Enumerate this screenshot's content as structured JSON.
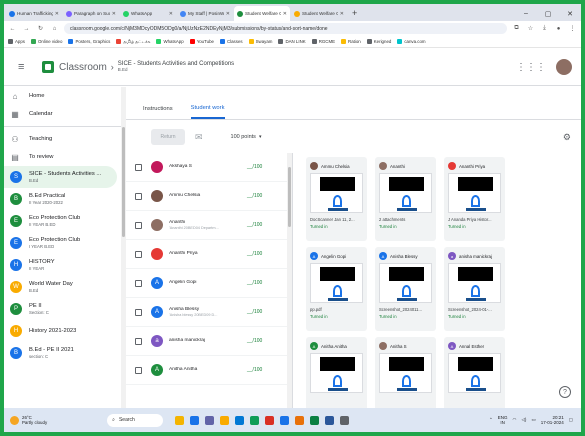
{
  "browser": {
    "tabs": [
      {
        "label": "Human Trafficking Awaren",
        "color": "#1a73e8"
      },
      {
        "label": "Paragraph on Success - C",
        "color": "#7b61ff"
      },
      {
        "label": "WhatsApp",
        "color": "#25d366"
      },
      {
        "label": "My Staff | PosinWyMail",
        "color": "#4285f4"
      },
      {
        "label": "Student Welfare Committ",
        "color": "#1e8e3e",
        "active": true
      },
      {
        "label": "Student Welfare Committ",
        "color": "#f9ab00"
      }
    ],
    "new_tab": "+",
    "window_controls": [
      "–",
      "▢",
      "✕"
    ],
    "url": "classroom.google.com/c/NjM3MDcyODM5ODg0/a/NjUzNzE2NDEyNjM3/submissions/by-status/and-sort-name/done",
    "bookmarks": [
      {
        "label": "Apps",
        "color": "#5f6368"
      },
      {
        "label": "Online video",
        "color": "#34a853"
      },
      {
        "label": "Posters, Graphics",
        "color": "#1a73e8"
      },
      {
        "label": "தமிழ் தட்டச்சு",
        "color": "#ea4335"
      },
      {
        "label": "WhatsApp",
        "color": "#25d366"
      },
      {
        "label": "YouTube",
        "color": "#ff0000"
      },
      {
        "label": "Classes",
        "color": "#1a73e8"
      },
      {
        "label": "Swayam",
        "color": "#fbbc04"
      },
      {
        "label": "DAN LINK",
        "color": "#5f6368"
      },
      {
        "label": "RGCME",
        "color": "#5f6368"
      },
      {
        "label": "Ration",
        "color": "#fbbc04"
      },
      {
        "label": "Kerigned",
        "color": "#5f6368"
      },
      {
        "label": "canva.com",
        "color": "#00c4cc"
      }
    ]
  },
  "header": {
    "app_name": "Classroom",
    "class_title": "SICE - Students Activities and Competitions",
    "class_subtitle": "B.Ed"
  },
  "sidebar": {
    "items": [
      {
        "label": "Home",
        "icon": "⌂"
      },
      {
        "label": "Calendar",
        "icon": "▦"
      }
    ],
    "teaching_label": "Teaching",
    "to_review_label": "To review",
    "classes": [
      {
        "initial": "S",
        "name": "SICE - Students Activities ...",
        "sub": "B.Ed",
        "color": "#1a73e8",
        "selected": true
      },
      {
        "initial": "B",
        "name": "B.Ed Practical",
        "sub": "II Year 2020-2022",
        "color": "#1e8e3e"
      },
      {
        "initial": "E",
        "name": "Eco Protection Club",
        "sub": "II YEAR B.ED",
        "color": "#1e8e3e"
      },
      {
        "initial": "E",
        "name": "Eco Protection Club",
        "sub": "I YEAR B.ED",
        "color": "#1a73e8"
      },
      {
        "initial": "H",
        "name": "HISTORY",
        "sub": "II YEAR",
        "color": "#1a73e8"
      },
      {
        "initial": "W",
        "name": "World Water Day",
        "sub": "B.Ed",
        "color": "#f9ab00"
      },
      {
        "initial": "P",
        "name": "PE II",
        "sub": "Section: C",
        "color": "#1e8e3e"
      },
      {
        "initial": "H",
        "name": "History 2021-2023",
        "sub": "",
        "color": "#f9ab00"
      },
      {
        "initial": "B",
        "name": "B.Ed - PE II 2021",
        "sub": "section: C",
        "color": "#1a73e8"
      }
    ]
  },
  "content_tabs": [
    "Instructions",
    "Student work"
  ],
  "toolbar": {
    "return_label": "Return",
    "points_label": "100 points",
    "points_caret": "▾"
  },
  "students": [
    {
      "name": "Akshaya S",
      "sub": "",
      "grade": "__/100",
      "color": "#c2185b"
    },
    {
      "name": "Ammu Chelsia",
      "sub": "",
      "grade": "__/100",
      "color": "#795548"
    },
    {
      "name": "Ananthi",
      "sub": "'Ananthi 20BED04 Departm...",
      "grade": "__/100",
      "color": "#8d6e63"
    },
    {
      "name": "Ananthi Priya",
      "sub": "",
      "grade": "__/100",
      "color": "#e53935"
    },
    {
      "name": "Angelin Gopi",
      "sub": "",
      "grade": "__/100",
      "color": "#1a73e8",
      "initial": "A"
    },
    {
      "name": "Anisha Blessy",
      "sub": "'Anisha blessy 20BED09 D...",
      "grade": "__/100",
      "color": "#1a73e8",
      "initial": "A"
    },
    {
      "name": "anisha manickraj",
      "sub": "",
      "grade": "__/100",
      "color": "#7e57c2",
      "initial": "a"
    },
    {
      "name": "Anitha Anitha",
      "sub": "",
      "grade": "__/100",
      "color": "#1e8e3e",
      "initial": "A"
    }
  ],
  "cards": [
    {
      "name": "Ammu Chelsia",
      "file": "",
      "status": "",
      "color": "#795548",
      "initial": ""
    },
    {
      "name": "Ananthi",
      "file": "",
      "status": "",
      "color": "#8d6e63",
      "initial": ""
    },
    {
      "name": "Ananthi Priya",
      "file": "",
      "status": "",
      "color": "#e53935",
      "initial": ""
    },
    {
      "name": "",
      "file": "DocScanner Jan 11, 2...",
      "status": "Turned in",
      "color": "",
      "initial": ""
    },
    {
      "name": "",
      "file": "2 attachments",
      "status": "Turned in",
      "color": "",
      "initial": ""
    },
    {
      "name": "",
      "file": "J Ananda Priya Histor...",
      "status": "Turned in",
      "color": "",
      "initial": ""
    },
    {
      "name": "Angelin Gopi",
      "file": "pp.pdf",
      "status": "Turned in",
      "color": "#1a73e8",
      "initial": "A"
    },
    {
      "name": "Anisha Blessy",
      "file": "Screenshot_2024011...",
      "status": "Turned in",
      "color": "#1a73e8",
      "initial": "A"
    },
    {
      "name": "anisha manickraj",
      "file": "Screenshot_2024-01-...",
      "status": "Turned in",
      "color": "#7e57c2",
      "initial": "a"
    },
    {
      "name": "Anitha Anitha",
      "file": "",
      "status": "",
      "color": "#1e8e3e",
      "initial": "A"
    },
    {
      "name": "Anitha S",
      "file": "",
      "status": "",
      "color": "#8d6e63",
      "initial": ""
    },
    {
      "name": "Annal Esther",
      "file": "",
      "status": "",
      "color": "#7e57c2",
      "initial": "A"
    }
  ],
  "taskbar": {
    "temp": "26°C",
    "weather": "Partly cloudy",
    "search": "Search",
    "lang": "ENG",
    "region": "IN",
    "time": "20:21",
    "date": "17-01-2024"
  }
}
